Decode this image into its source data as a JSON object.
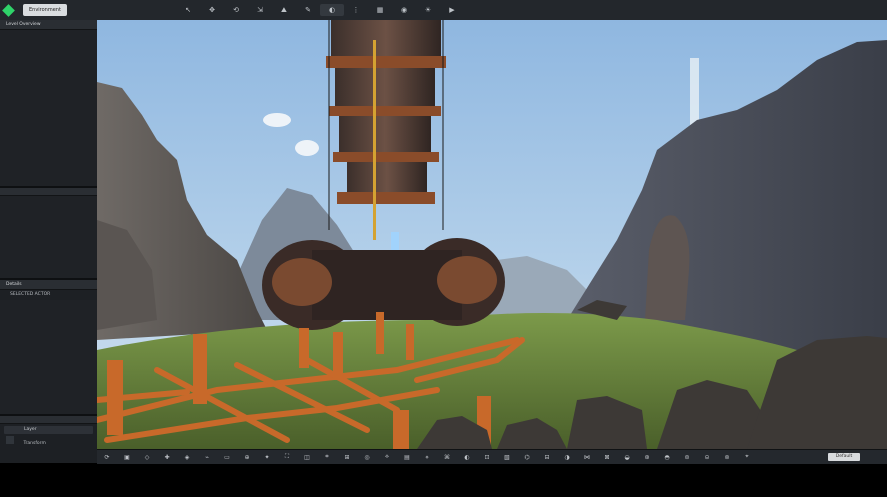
{
  "topbar": {
    "tab_label": "Environment",
    "tools": [
      {
        "name": "select-tool-icon",
        "glyph": "↖"
      },
      {
        "name": "move-tool-icon",
        "glyph": "✥"
      },
      {
        "name": "rotate-tool-icon",
        "glyph": "⟲"
      },
      {
        "name": "scale-tool-icon",
        "glyph": "⇲"
      },
      {
        "name": "terrain-tool-icon",
        "glyph": "⛰"
      },
      {
        "name": "paint-tool-icon",
        "glyph": "✎"
      },
      {
        "name": "material-tool-icon",
        "glyph": "◐"
      },
      {
        "name": "snap-tool-icon",
        "glyph": "⋮"
      },
      {
        "name": "grid-tool-icon",
        "glyph": "▦"
      },
      {
        "name": "camera-tool-icon",
        "glyph": "◉"
      },
      {
        "name": "light-tool-icon",
        "glyph": "☀"
      },
      {
        "name": "play-tool-icon",
        "glyph": "▶"
      }
    ]
  },
  "left": {
    "panel1_title": "Level Overview",
    "panel2_title": "Details",
    "panel2_row": "SELECTED ACTOR",
    "bottom_label_1": "Layer",
    "bottom_label_2": "Transform"
  },
  "bottombar": {
    "field_value": "Default",
    "icons": [
      "⟳",
      "▣",
      "◇",
      "✚",
      "◈",
      "⌁",
      "▭",
      "⊕",
      "✦",
      "⛶",
      "◫",
      "⌗",
      "⊞",
      "◎",
      "⟡",
      "▤",
      "⋄",
      "⌘",
      "◐",
      "⊡",
      "▧",
      "⌬",
      "⊟",
      "◑",
      "⋈",
      "⊠",
      "◒",
      "⊛",
      "◓",
      "⊜",
      "⊝",
      "⊚",
      "⌖"
    ]
  },
  "colors": {
    "accent": "#2fd36a",
    "sky_top": "#9fc3e6",
    "grass": "#5f7a38",
    "pipe": "#c8692a"
  }
}
